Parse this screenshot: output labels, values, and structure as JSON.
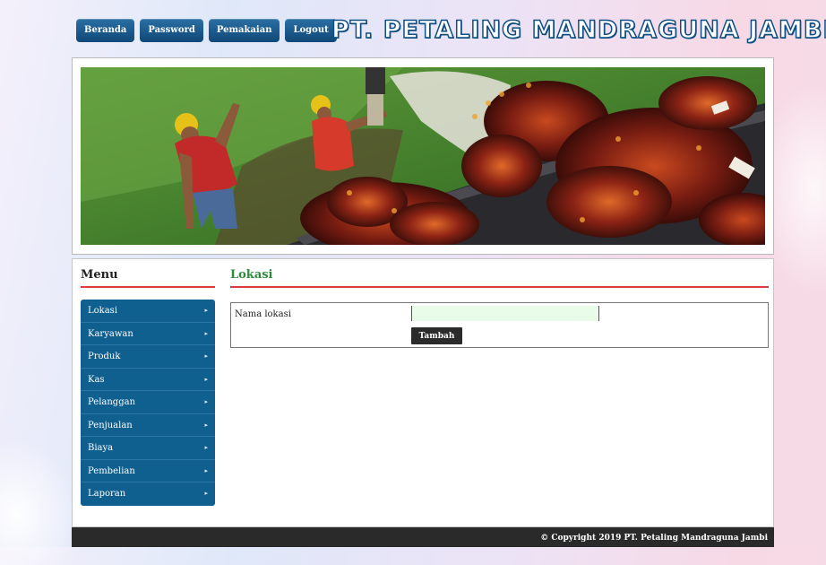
{
  "nav": {
    "items": [
      {
        "label": "Beranda"
      },
      {
        "label": "Password"
      },
      {
        "label": "Pemakaian"
      },
      {
        "label": "Logout"
      }
    ]
  },
  "site_title": "PT. PETALING MANDRAGUNA JAMBI",
  "sidebar": {
    "heading": "Menu",
    "items": [
      {
        "label": "Lokasi"
      },
      {
        "label": "Karyawan"
      },
      {
        "label": "Produk"
      },
      {
        "label": "Kas"
      },
      {
        "label": "Pelanggan"
      },
      {
        "label": "Penjualan"
      },
      {
        "label": "Biaya"
      },
      {
        "label": "Pembelian"
      },
      {
        "label": "Laporan"
      }
    ],
    "arrow_glyph": "▸"
  },
  "main": {
    "heading": "Lokasi",
    "form": {
      "field_label": "Nama lokasi",
      "field_value": "",
      "submit_label": "Tambah"
    }
  },
  "footer": {
    "copyright": "© Copyright 2019 PT. Petaling Mandraguna Jambi"
  },
  "colors": {
    "nav_button": "#0f4877",
    "menu_bg": "#0f5f8f",
    "heading_green": "#2e8b3e",
    "accent_red": "#d93a3a",
    "input_bg": "#e9fbe9",
    "footer_bg": "#2a2a2a"
  }
}
